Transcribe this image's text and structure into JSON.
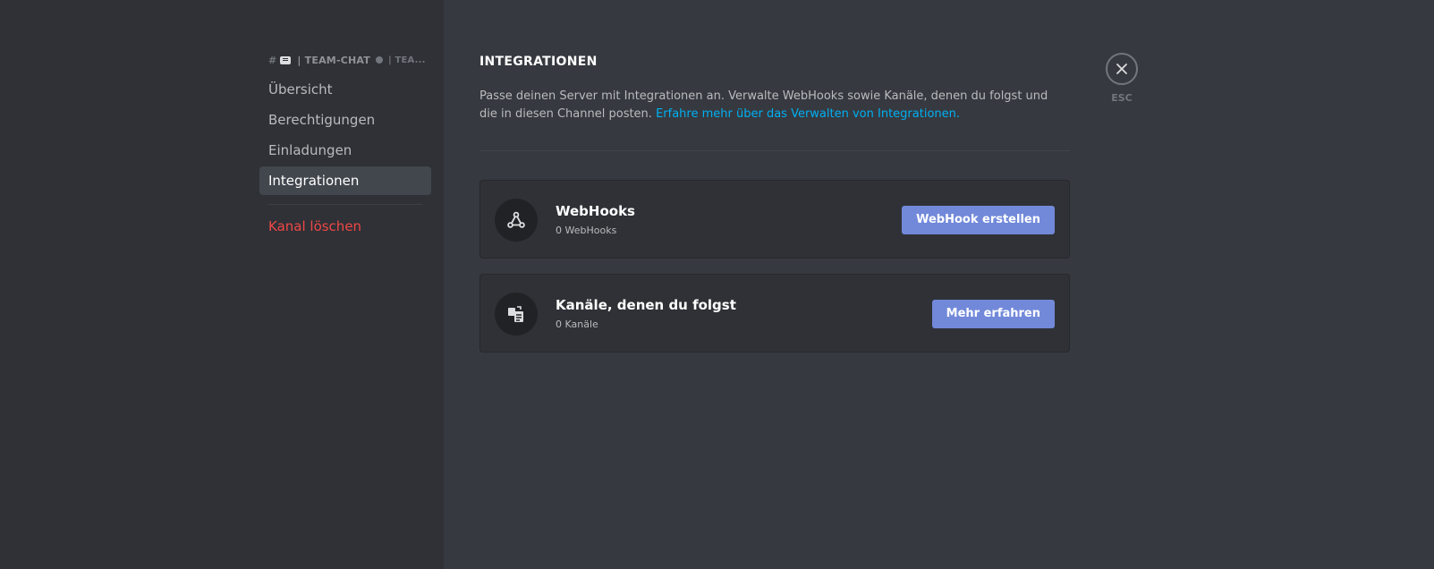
{
  "sidebar": {
    "channel_header": {
      "hash_glyph": "#",
      "name": "| TEAM-CHAT",
      "truncated": "| TEA..."
    },
    "items": [
      {
        "label": "Übersicht"
      },
      {
        "label": "Berechtigungen"
      },
      {
        "label": "Einladungen"
      },
      {
        "label": "Integrationen",
        "selected": true
      }
    ],
    "delete_label": "Kanal löschen"
  },
  "main": {
    "title": "INTEGRATIONEN",
    "description": "Passe deinen Server mit Integrationen an. Verwalte WebHooks sowie Kanäle, denen du folgst und die in diesen Channel posten.",
    "learn_more_link": "Erfahre mehr über das Verwalten von Integrationen.",
    "cards": [
      {
        "icon": "webhook-icon",
        "title": "WebHooks",
        "subtitle": "0 WebHooks",
        "button_label": "WebHook erstellen"
      },
      {
        "icon": "followed-channel-icon",
        "title": "Kanäle, denen du folgst",
        "subtitle": "0 Kanäle",
        "button_label": "Mehr erfahren"
      }
    ]
  },
  "close": {
    "icon": "close-icon",
    "label": "ESC"
  },
  "colors": {
    "background": "#36393f",
    "sidebar": "#2f3136",
    "accent": "#7289da",
    "link": "#00b0f4",
    "danger": "#f04747"
  }
}
